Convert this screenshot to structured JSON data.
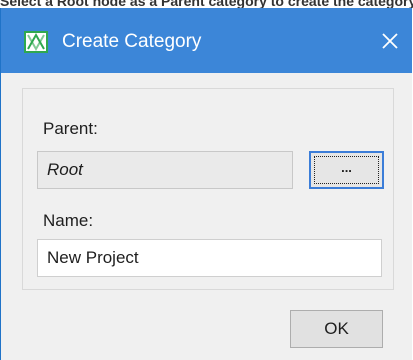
{
  "caption": "Select a Root node as a Parent category to create the category in the root.",
  "window": {
    "title": "Create Category",
    "icon": "category-icon",
    "close_icon": "close-icon",
    "colors": {
      "titlebar": "#3c86d8",
      "icon_green": "#2fa84f",
      "focus_border": "#3b7dd8"
    }
  },
  "form": {
    "parent_label": "Parent:",
    "parent_value": "Root",
    "browse_label": "...",
    "name_label": "Name:",
    "name_value": "New Project"
  },
  "buttons": {
    "ok_label": "OK"
  }
}
